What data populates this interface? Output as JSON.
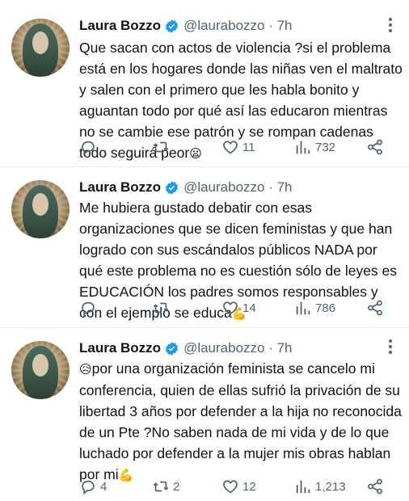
{
  "tweets": [
    {
      "name": "Laura Bozzo",
      "handle": "@laurabozzo · 7h",
      "text": "Que sacan con actos de violencia ?si el problema está en los hogares donde las niñas ven el maltrato y salen con el primero que les habla bonito y aguantan todo por qué así las educaron mientras no se cambie ese patrón y se rompan cadenas todo seguirá peor",
      "text_emoji": "😦",
      "replies": "",
      "retweets": "",
      "likes": "11",
      "views": "732"
    },
    {
      "name": "Laura Bozzo",
      "handle": "@laurabozzo · 7h",
      "text": "Me hubiera gustado debatir con esas organizaciones que se dicen feministas y que han logrado con sus escándalos públicos NADA por qué este problema no es cuestión sólo de leyes es EDUCACIÓN los padres somos responsables y con el ejemplo se educa",
      "text_emoji": "💪",
      "replies": "",
      "retweets": "",
      "likes": "14",
      "views": "786"
    },
    {
      "name": "Laura Bozzo",
      "handle": "@laurabozzo · 7h",
      "text_lead_emoji": "😥",
      "text": "por una organización feminista se cancelo mi conferencia, quien de ellas sufrió la privación de su libertad 3 años por defender a la hija no reconocida de un Pte ?No saben nada de mi vida y de lo que luchado por defender a la mujer mis obras hablan por mi",
      "text_emoji": "💪",
      "replies": "4",
      "retweets": "2",
      "likes": "12",
      "views": "1,213"
    }
  ],
  "icons": {
    "verified": "verified-badge-icon",
    "more": "more-icon",
    "reply": "reply-icon",
    "retweet": "retweet-icon",
    "like": "heart-icon",
    "views": "views-icon",
    "share": "share-icon"
  },
  "colors": {
    "verified": "#1d9bf0",
    "text": "#0f1419",
    "secondary": "#536471",
    "divider": "#e6ecf0"
  }
}
